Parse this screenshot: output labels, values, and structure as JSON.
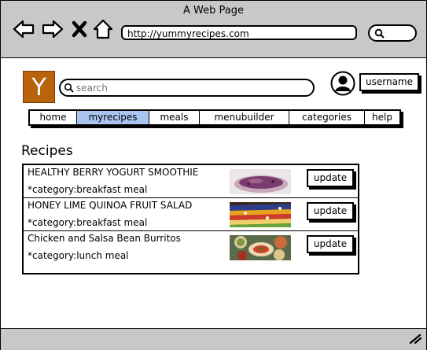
{
  "browser": {
    "title": "A Web Page",
    "url": "http://yummyrecipes.com"
  },
  "header": {
    "logo_letter": "Y",
    "logo_color": "#b8620a",
    "search_placeholder": "search",
    "username": "username"
  },
  "nav": {
    "tabs": [
      {
        "label": "home",
        "active": false
      },
      {
        "label": "myrecipes",
        "active": true
      },
      {
        "label": "meals",
        "active": false
      },
      {
        "label": "menubuilder",
        "active": false
      },
      {
        "label": "categories",
        "active": false
      },
      {
        "label": "help",
        "active": false
      }
    ],
    "active_color": "#a9c5ef"
  },
  "main": {
    "section_title": "Recipes",
    "update_label": "update",
    "recipes": [
      {
        "name": "HEALTHY BERRY YOGURT SMOOTHIE",
        "category": "*category:breakfast meal"
      },
      {
        "name": "HONEY LIME QUINOA FRUIT SALAD",
        "category": "*category:breakfast meal"
      },
      {
        "name": "Chicken and Salsa Bean Burritos",
        "category": "*category:lunch meal"
      }
    ]
  }
}
